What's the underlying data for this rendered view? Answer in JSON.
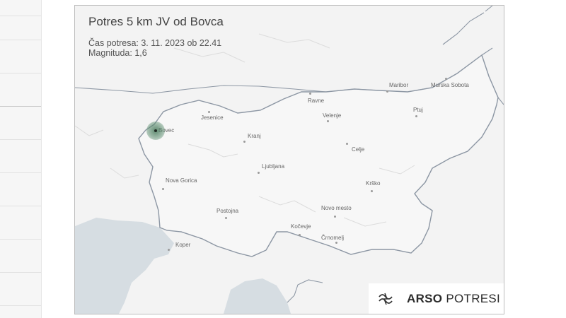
{
  "map": {
    "title": "Potres 5 km JV od Bovca",
    "info_line1": "Čas potresa: 3. 11. 2023 ob 22.41",
    "info_line2": "Magnituda: 1,6",
    "epicenter_label": "Bovec",
    "cities": {
      "maribor": "Maribor",
      "murska_sobota": "Murska Sobota",
      "ptuj": "Ptuj",
      "ravne": "Ravne",
      "velenje": "Velenje",
      "celje": "Celje",
      "jesenice": "Jesenice",
      "kranj": "Kranj",
      "ljubljana": "Ljubljana",
      "nova_gorica": "Nova Gorica",
      "krsko": "Krško",
      "postojna": "Postojna",
      "novo_mesto": "Novo mesto",
      "kocevje": "Kočevje",
      "crnomelj": "Črnomelj",
      "koper": "Koper"
    },
    "colors": {
      "land": "#f3f3f3",
      "sea": "#d6dde2",
      "border": "#8d97a4",
      "epicenter": "#5f8f72"
    }
  },
  "logo": {
    "bold": "ARSO",
    "regular": "POTRESI",
    "icon": "arso-wave-icon"
  }
}
